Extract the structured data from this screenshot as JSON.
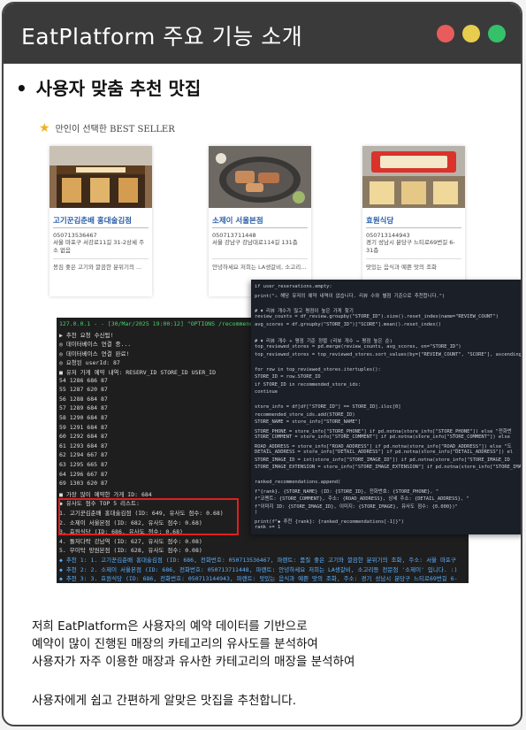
{
  "window": {
    "title": "EatPlatform 주요 기능 소개"
  },
  "section": {
    "bullet": "•",
    "heading": "사용자 맞춤 추천 맛집"
  },
  "best_seller": {
    "header": "만인이 선택한 BEST SELLER",
    "cards": [
      {
        "name": "고기꾼김춘배 홍대술김점",
        "phone": "050713536467",
        "address": "서울 마포구 서강로11길 31-2상세 주소 없음",
        "desc": "봉짐 좋은 고기와 깔끔한 분위기의 ..."
      },
      {
        "name": "소제이 서울본점",
        "phone": "050713711448",
        "address": "서울 강남구 강남대로114길 131층",
        "desc": "안녕하세요 저희는 LA생갈비, 소고리..."
      },
      {
        "name": "효원식당",
        "phone": "050713144943",
        "address": "경기 성남시 분당구 느티로69번길 6-31층",
        "desc": "맛있는 음식과 예쁜 맛의 조화"
      }
    ]
  },
  "terminal": {
    "lines": [
      {
        "t": "127.0.0.1 - - [30/Mar/2025 19:00:12] \"OPTIONS /recommend",
        "c": "green"
      },
      {
        "t": "▶ 추천 요청 수신됨!",
        "c": ""
      },
      {
        "t": "◎ 데이터베이스 연결 중...",
        "c": ""
      },
      {
        "t": "◎ 데이터베이스 연결 완료!",
        "c": ""
      },
      {
        "t": "◎ 요청된 userId: 87",
        "c": ""
      },
      {
        "t": "■ 유저 가게 예약 내역:        RESERV_ID  STORE_ID  USER_ID",
        "c": ""
      },
      {
        "t": "54          1286        686        87",
        "c": ""
      },
      {
        "t": "55          1287        620        87",
        "c": ""
      },
      {
        "t": "56          1288        684        87",
        "c": ""
      },
      {
        "t": "57          1289        684        87",
        "c": ""
      },
      {
        "t": "58          1290        684        87",
        "c": ""
      },
      {
        "t": "59          1291        684        87",
        "c": ""
      },
      {
        "t": "60          1292        684        87",
        "c": ""
      },
      {
        "t": "61          1293        684        87",
        "c": ""
      },
      {
        "t": "62          1294        667        87",
        "c": ""
      },
      {
        "t": "63          1295        665        87",
        "c": ""
      },
      {
        "t": "64          1296        667        87",
        "c": ""
      },
      {
        "t": "69          1303        620        87",
        "c": ""
      },
      {
        "t": "■ 가장 많이 예약한 가게 ID: 684",
        "c": ""
      },
      {
        "t": "◆ 유사도 점수 TOP 5 리스트:",
        "c": ""
      },
      {
        "t": "1. 고기꾼김춘배 홍대술김점 (ID: 649, 유사도 점수: 0.68)",
        "c": ""
      },
      {
        "t": "2. 소제이 서울본점 (ID: 682, 유사도 점수: 0.68)",
        "c": ""
      },
      {
        "t": "3. 효원식당 (ID: 686, 유사도 점수: 0.68)",
        "c": ""
      },
      {
        "t": "4. 돌저다락 강남역 (ID: 627, 유사도 점수: 0.08)",
        "c": ""
      },
      {
        "t": "5. 무이탁 망원본점 (ID: 628, 유사도 점수: 0.08)",
        "c": ""
      },
      {
        "t": "◆ 추천 1: 1. 고기꾼김춘배 홍대술김점 (ID: 686, 전화번호: 050713536467, 파랜트: 품질 좋은 고기와 깔끔한 분위기의 조화, 주소: 서울 마포구",
        "c": "blue"
      },
      {
        "t": "◆ 추천 2: 2. 소제이 서울본점 (ID: 686, 전화번호: 050713711448, 파랜트: 안녕하세요 저희는 LA생갈비, 소고리등 전문점 '소제이' 입니다. :)",
        "c": "blue"
      },
      {
        "t": "◆ 추천 3: 3. 효원식당 (ID: 686, 전화번호: 050713144943, 파랜트: 맛있는 음식과 예쁜 맛의 조화, 주소: 경기 성남시 분당구 느티로69번길 6-",
        "c": "blue"
      }
    ]
  },
  "code": {
    "lines": [
      "if user_reservations.empty:",
      "    print(\"⚠ 해당 유저의 예약 내역이 없습니다. 리뷰 수와 별점 기준으로 추천합니다.\")",
      "",
      "    # ♦ 리뷰 개수가 많고 평점이 높은 가게 찾기",
      "    review_counts = df_review.groupby(\"STORE_ID\").size().reset_index(name=\"REVIEW_COUNT\")",
      "    avg_scores = df.groupby(\"STORE_ID\")[\"SCORE\"].mean().reset_index()",
      "",
      "    # ♦ 리뷰 개수 + 평점 기준 정렬 (리뷰 개수 → 평점 높은 순)",
      "    top_reviewed_stores = pd.merge(review_counts, avg_scores, on=\"STORE_ID\")",
      "    top_reviewed_stores = top_reviewed_stores.sort_values(by=[\"REVIEW_COUNT\", \"SCORE\"], ascending=",
      "",
      "    for row in top_reviewed_stores.itertuples():",
      "        STORE_ID = row.STORE_ID",
      "        if STORE_ID in recommended_store_ids:",
      "            continue",
      "",
      "        store_info = df[df[\"STORE_ID\"] == STORE_ID].iloc[0]",
      "        recommended_store_ids.add(STORE_ID)",
      "        STORE_NAME = store_info[\"STORE_NAME\"]",
      "        STORE_PHONE = store_info[\"STORE_PHONE\"] if pd.notna(store_info[\"STORE_PHONE\"]) else \"전화번",
      "        STORE_COMMENT = store_info[\"STORE_COMMENT\"] if pd.notna(store_info[\"STORE_COMMENT\"]) else",
      "        ROAD_ADDRESS = store_info[\"ROAD_ADDRESS\"] if pd.notna(store_info[\"ROAD_ADDRESS\"]) else \"도",
      "        DETAIL_ADDRESS = store_info[\"DETAIL_ADDRESS\"] if pd.notna(store_info[\"DETAIL_ADDRESS\"]) el",
      "        STORE_IMAGE_ID = int(store_info[\"STORE_IMAGE_ID\"]) if pd.notna(store_info[\"STORE_IMAGE_ID",
      "        STORE_IMAGE_EXTENSION = store_info[\"STORE_IMAGE_EXTENSION\"] if pd.notna(store_info[\"STORE_IMAGE_EXTE",
      "",
      "        ranked_recommendations.append(",
      "            f\"{rank}. {STORE_NAME} (ID: {STORE_ID}, 전화번호: {STORE_PHONE}, \"",
      "            f\"코멘트: {STORE_COMMENT}, 주소: {ROAD_ADDRESS}, 상세 주소: {DETAIL_ADDRESS}, \"",
      "            f\"이미지 ID: {STORE_IMAGE_ID}, 이미지: {STORE_IMAGE}, 유사도 점수: {0.000})\"",
      "        )",
      "        print(f\"◆ 추천 {rank}: {ranked_recommendations[-1]}\")",
      "        rank += 1"
    ]
  },
  "description": {
    "lines": [
      "저희 EatPlatform은 사용자의 예약 데이터를 기반으로",
      "예약이 많이 진행된 매장의 카테고리의 유사도를 분석하여",
      "사용자가 자주 이용한 매장과 유사한 카테고리의 매장을 분석하여",
      "",
      "사용자에게 쉽고 간편하게 알맞은 맛집을 추천합니다."
    ]
  }
}
